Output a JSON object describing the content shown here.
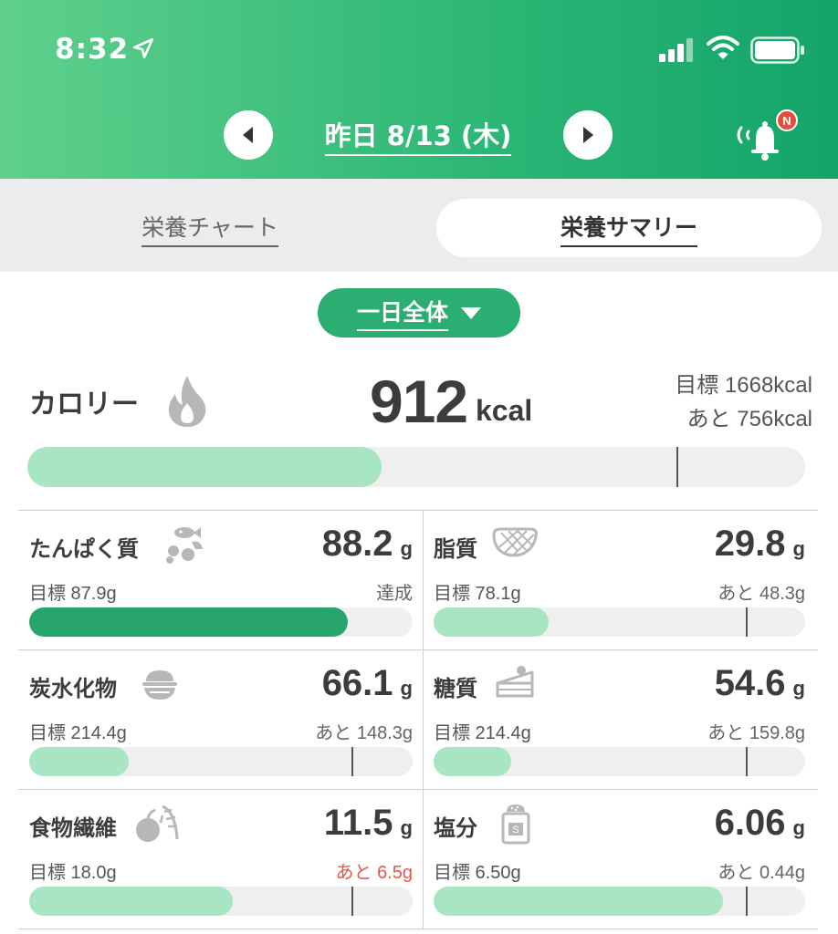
{
  "status_bar": {
    "time": "8:32"
  },
  "header": {
    "date": "昨日 8/13 (木)",
    "badge": "N"
  },
  "tabs": [
    {
      "label": "栄養チャート",
      "active": false
    },
    {
      "label": "栄養サマリー",
      "active": true
    }
  ],
  "period": {
    "label": "一日全体"
  },
  "calorie": {
    "title": "カロリー",
    "value": "912",
    "unit": "kcal",
    "goal": "目標 1668kcal",
    "remain": "あと 756kcal",
    "progress": 0.455,
    "goal_mark": 0.835
  },
  "nutrients": [
    {
      "name": "たんぱく質",
      "icon": "protein-icon",
      "value": "88.2",
      "unit": "g",
      "goal": "目標 87.9g",
      "remain": "達成",
      "remain_red": false,
      "progress": 0.83,
      "done": true,
      "goal_mark": null
    },
    {
      "name": "脂質",
      "icon": "fat-icon",
      "value": "29.8",
      "unit": "g",
      "goal": "目標 78.1g",
      "remain": "あと 48.3g",
      "remain_red": false,
      "progress": 0.31,
      "done": false,
      "goal_mark": 0.84
    },
    {
      "name": "炭水化物",
      "icon": "rice-bowl-icon",
      "value": "66.1",
      "unit": "g",
      "goal": "目標 214.4g",
      "remain": "あと 148.3g",
      "remain_red": false,
      "progress": 0.26,
      "done": false,
      "goal_mark": 0.84
    },
    {
      "name": "糖質",
      "icon": "cake-icon",
      "value": "54.6",
      "unit": "g",
      "goal": "目標 214.4g",
      "remain": "あと 159.8g",
      "remain_red": false,
      "progress": 0.21,
      "done": false,
      "goal_mark": 0.84
    },
    {
      "name": "食物繊維",
      "icon": "vegetable-icon",
      "value": "11.5",
      "unit": "g",
      "goal": "目標 18.0g",
      "remain": "あと 6.5g",
      "remain_red": true,
      "progress": 0.53,
      "done": false,
      "goal_mark": 0.84
    },
    {
      "name": "塩分",
      "icon": "salt-shaker-icon",
      "value": "6.06",
      "unit": "g",
      "goal": "目標 6.50g",
      "remain": "あと 0.44g",
      "remain_red": false,
      "progress": 0.78,
      "done": false,
      "goal_mark": 0.84
    }
  ],
  "colors": {
    "header_green": "#2fb877",
    "bar_fill": "#a8e6c3",
    "bar_done": "#27a56c",
    "warn_red": "#e05a4c"
  }
}
